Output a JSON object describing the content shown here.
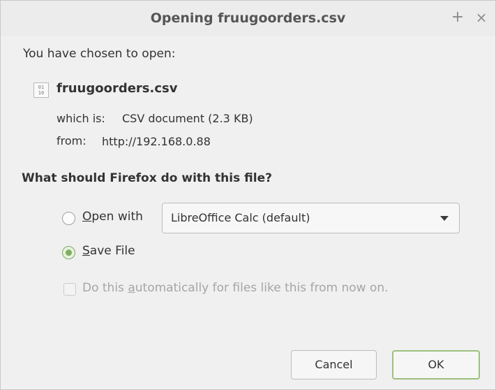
{
  "window": {
    "title": "Opening fruugoorders.csv",
    "maximize_glyph": "+",
    "close_glyph": "×"
  },
  "intro": "You have chosen to open:",
  "file": {
    "icon": "csv-file-icon",
    "icon_glyph": "01 10",
    "name": "fruugoorders.csv",
    "which_is_label": "which is:",
    "which_is_value": "CSV document (2.3 KB)",
    "from_label": "from:",
    "from_value": "http://192.168.0.88"
  },
  "question": "What should Firefox do with this file?",
  "options": {
    "open_with": {
      "mnemonic": "O",
      "rest": "pen with",
      "selected": false,
      "app": "LibreOffice Calc (default)"
    },
    "save_file": {
      "mnemonic": "S",
      "rest": "ave File",
      "selected": true
    }
  },
  "auto": {
    "before": "Do this ",
    "mnemonic": "a",
    "after": "utomatically for files like this from now on.",
    "checked": false,
    "enabled": false
  },
  "buttons": {
    "cancel": "Cancel",
    "ok": "OK"
  },
  "colors": {
    "accent": "#7fae5c",
    "disabled_text": "#a5a5a5"
  }
}
